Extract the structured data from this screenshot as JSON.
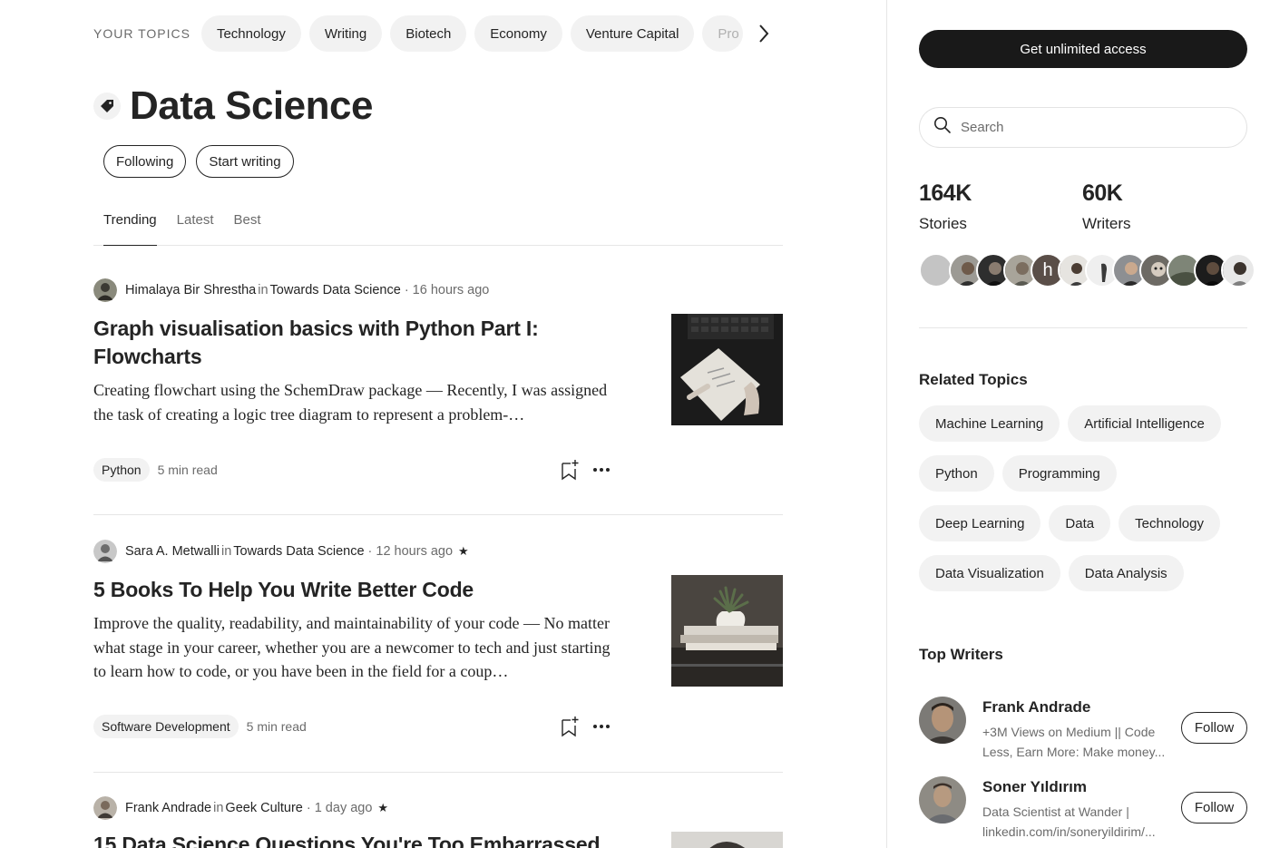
{
  "topics_bar": {
    "label": "YOUR TOPICS",
    "items": [
      "Technology",
      "Writing",
      "Biotech",
      "Economy",
      "Venture Capital",
      "Pro"
    ]
  },
  "page": {
    "title": "Data Science",
    "following_label": "Following",
    "start_writing_label": "Start writing"
  },
  "tabs": [
    "Trending",
    "Latest",
    "Best"
  ],
  "articles": [
    {
      "author": "Himalaya Bir Shrestha",
      "in": "in",
      "publication": "Towards Data Science",
      "time": "· 16 hours ago",
      "star": "",
      "title": "Graph visualisation basics with Python Part I: Flowcharts",
      "excerpt": "Creating flowchart using the SchemDraw package — Recently, I was assigned the task of creating a logic tree diagram to represent a problem-…",
      "tag": "Python",
      "read_time": "5 min read"
    },
    {
      "author": "Sara A. Metwalli",
      "in": "in",
      "publication": "Towards Data Science",
      "time": "· 12 hours ago",
      "star": "★",
      "title": "5 Books To Help You Write Better Code",
      "excerpt": "Improve the quality, readability, and maintainability of your code — No matter what stage in your career, whether you are a newcomer to tech and just starting to learn how to code, or you have been in the field for a coup…",
      "tag": "Software Development",
      "read_time": "5 min read"
    },
    {
      "author": "Frank Andrade",
      "in": "in",
      "publication": "Geek Culture",
      "time": "· 1 day ago",
      "star": "★",
      "title": "15 Data Science Questions You're Too Embarrassed",
      "excerpt": "",
      "tag": "",
      "read_time": ""
    }
  ],
  "sidebar": {
    "cta_label": "Get unlimited access",
    "search_placeholder": "Search",
    "stats": [
      {
        "value": "164K",
        "label": "Stories"
      },
      {
        "value": "60K",
        "label": "Writers"
      }
    ],
    "avatar_letter": "h",
    "related_heading": "Related Topics",
    "related_topics": [
      [
        "Machine Learning",
        "Artificial Intelligence"
      ],
      [
        "Python",
        "Programming"
      ],
      [
        "Deep Learning",
        "Data",
        "Technology"
      ],
      [
        "Data Visualization",
        "Data Analysis"
      ]
    ],
    "top_writers_heading": "Top Writers",
    "writers": [
      {
        "name": "Frank Andrade",
        "bio": "+3M Views on Medium || Code Less, Earn More: Make money...",
        "follow": "Follow"
      },
      {
        "name": "Soner Yıldırım",
        "bio": "Data Scientist at Wander | linkedin.com/in/soneryildirim/...",
        "follow": "Follow"
      }
    ]
  }
}
